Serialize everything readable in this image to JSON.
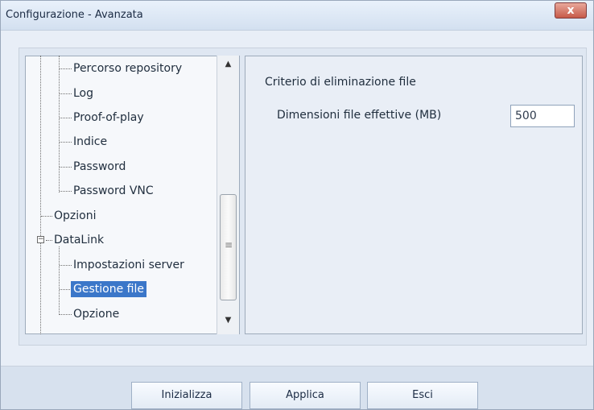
{
  "window": {
    "title": "Configurazione - Avanzata",
    "close_glyph": "x"
  },
  "tree": {
    "items": [
      {
        "label": "Percorso repository"
      },
      {
        "label": "Log"
      },
      {
        "label": "Proof-of-play"
      },
      {
        "label": "Indice"
      },
      {
        "label": "Password"
      },
      {
        "label": "Password VNC"
      },
      {
        "label": "Opzioni"
      },
      {
        "label": "DataLink",
        "expanded": true
      },
      {
        "label": "Impostazioni server"
      },
      {
        "label": "Gestione file",
        "selected": true
      },
      {
        "label": "Opzione"
      }
    ],
    "scroll": {
      "up": "▲",
      "down": "▼",
      "thumb_grip": "≡"
    }
  },
  "panel": {
    "section_title": "Criterio di eliminazione file",
    "field_label": "Dimensioni file effettive (MB)",
    "field_value": "500"
  },
  "buttons": {
    "initialize": "Inizializza",
    "apply": "Applica",
    "exit": "Esci"
  },
  "colors": {
    "selection": "#3b77c9",
    "close_button": "#c65a49"
  }
}
